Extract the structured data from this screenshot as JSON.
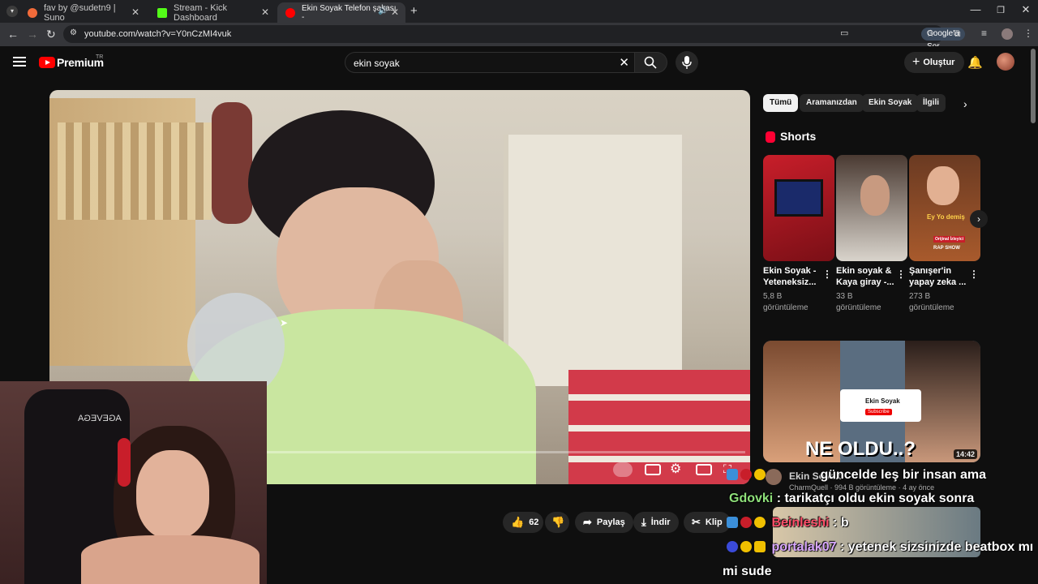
{
  "browser": {
    "tabs": [
      {
        "title": "fav by @sudetn9 | Suno",
        "favicon_color": "#f26b3a"
      },
      {
        "title": "Stream - Kick Dashboard",
        "favicon_color": "#53fc18"
      },
      {
        "title": "Ekin Soyak Telefon şakası -",
        "favicon_color": "#ff0000"
      }
    ],
    "url": "youtube.com/watch?v=Y0nCzMI4vuk",
    "ask_google": "Google'a Sor"
  },
  "yt": {
    "logo_text": "Premium",
    "logo_region": "TR",
    "search_value": "ekin soyak",
    "create_label": "Oluştur"
  },
  "actions": {
    "like_count": "62",
    "share_label": "Paylaş",
    "download_label": "İndir",
    "clip_label": "Klip"
  },
  "chips": [
    "Tümü",
    "Aramanızdan",
    "Ekin Soyak",
    "İlgili"
  ],
  "shorts": {
    "title": "Shorts",
    "items": [
      {
        "title": "Ekin Soyak - Yeteneksiz...",
        "views": "5,8 B görüntüleme"
      },
      {
        "title": "Ekin soyak & Kaya giray -...",
        "views": "33 B görüntüleme"
      },
      {
        "title": "Şanışer'in yapay zeka ...",
        "views": "273 B görüntüleme"
      }
    ],
    "thumb3_text1": "Ey Yo demiş",
    "thumb3_text2": "Orijinal İzleyici",
    "thumb3_text3": "RAP SHOW"
  },
  "recommended": {
    "caption": "NE OLDU..?",
    "duration": "14:42",
    "thumb_channel": "Ekin Soyak",
    "thumb_subscribe": "Subscribe",
    "channel_partial": "Ekin Soyak",
    "meta": "CharmQuell · 994 B görüntüleme · 4 ay önce"
  },
  "chat": [
    {
      "user": "",
      "text": "güncelde leş bir insan ama",
      "user_color": "#ff6a6a"
    },
    {
      "user": "Gdovki",
      "text": ": tarikatçı oldu ekin soyak sonra",
      "user_color": "#8ee07a"
    },
    {
      "user": "Beinleshi",
      "text": ": b",
      "user_color": "#ff4f6a"
    },
    {
      "user": "portalak07",
      "text": ": yetenek sizsinizde beatbox mı",
      "user_color": "#d9a8ff"
    },
    {
      "user": "",
      "text": "mi sude",
      "user_color": "#ffffff"
    }
  ],
  "webcam": {
    "chair_text": "AGEVEGA"
  }
}
